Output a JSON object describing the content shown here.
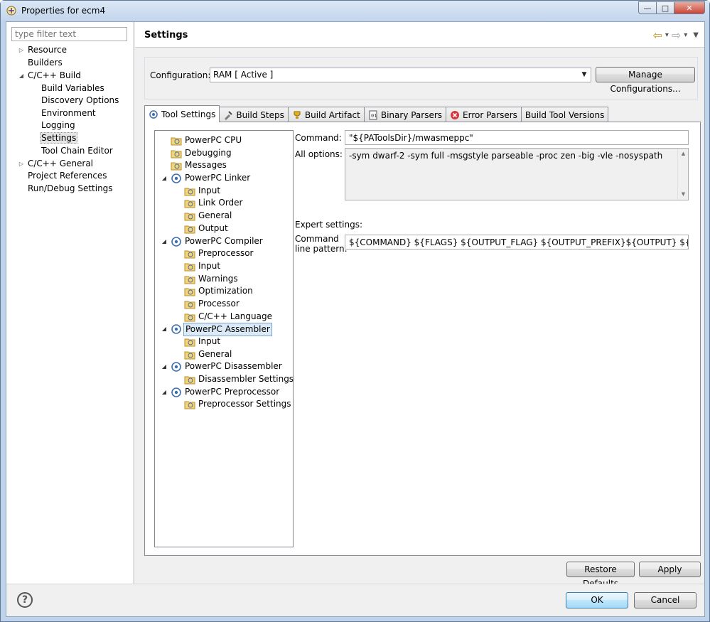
{
  "window": {
    "title": "Properties for ecm4",
    "minimize_glyph": "—",
    "maximize_glyph": "□",
    "close_glyph": "✕"
  },
  "filter": {
    "placeholder": "type filter text"
  },
  "nav": {
    "items": [
      {
        "label": "Resource",
        "expander": "▷"
      },
      {
        "label": "Builders"
      },
      {
        "label": "C/C++ Build",
        "expander": "◢"
      },
      {
        "label": "Build Variables"
      },
      {
        "label": "Discovery Options"
      },
      {
        "label": "Environment"
      },
      {
        "label": "Logging"
      },
      {
        "label": "Settings"
      },
      {
        "label": "Tool Chain Editor"
      },
      {
        "label": "C/C++ General",
        "expander": "▷"
      },
      {
        "label": "Project References"
      },
      {
        "label": "Run/Debug Settings"
      }
    ]
  },
  "header": {
    "title": "Settings",
    "back_glyph": "⇦",
    "forward_glyph": "⇨",
    "dropdown_glyph": "▾",
    "menu_glyph": "▼"
  },
  "configuration": {
    "label": "Configuration:",
    "value": "RAM  [ Active ]",
    "arrow": "▼",
    "manage_button": "Manage Configurations..."
  },
  "tabs": [
    {
      "label": "Tool Settings"
    },
    {
      "label": "Build Steps"
    },
    {
      "label": "Build Artifact"
    },
    {
      "label": "Binary Parsers"
    },
    {
      "label": "Error Parsers"
    },
    {
      "label": "Build Tool Versions"
    }
  ],
  "tree": {
    "items": [
      {
        "label": "PowerPC CPU"
      },
      {
        "label": "Debugging"
      },
      {
        "label": "Messages"
      },
      {
        "label": "PowerPC Linker",
        "expander": "◢"
      },
      {
        "label": "Input"
      },
      {
        "label": "Link Order"
      },
      {
        "label": "General"
      },
      {
        "label": "Output"
      },
      {
        "label": "PowerPC Compiler",
        "expander": "◢"
      },
      {
        "label": "Preprocessor"
      },
      {
        "label": "Input"
      },
      {
        "label": "Warnings"
      },
      {
        "label": "Optimization"
      },
      {
        "label": "Processor"
      },
      {
        "label": "C/C++ Language"
      },
      {
        "label": "PowerPC Assembler",
        "expander": "◢"
      },
      {
        "label": "Input"
      },
      {
        "label": "General"
      },
      {
        "label": "PowerPC Disassembler",
        "expander": "◢"
      },
      {
        "label": "Disassembler Settings"
      },
      {
        "label": "PowerPC Preprocessor",
        "expander": "◢"
      },
      {
        "label": "Preprocessor Settings"
      }
    ]
  },
  "options": {
    "command_label": "Command:",
    "command_value": "\"${PAToolsDir}/mwasmeppc\"",
    "all_options_label": "All options:",
    "all_options_value": "-sym dwarf-2 -sym full -msgstyle parseable -proc zen -big -vle -nosyspath",
    "scroll_up": "▲",
    "scroll_down": "▼",
    "expert_label": "Expert settings:",
    "pattern_label_1": "Command",
    "pattern_label_2": "line pattern:",
    "pattern_value": "${COMMAND} ${FLAGS} ${OUTPUT_FLAG} ${OUTPUT_PREFIX}${OUTPUT} ${INPUTS}"
  },
  "buttons": {
    "restore_defaults": "Restore Defaults",
    "apply": "Apply",
    "ok": "OK",
    "cancel": "Cancel",
    "help": "?"
  }
}
